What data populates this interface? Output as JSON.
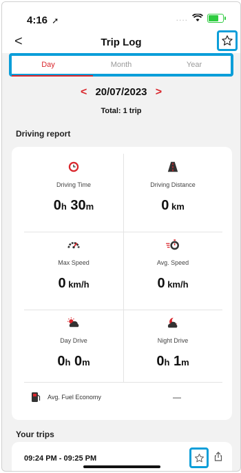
{
  "status_bar": {
    "time": "4:16",
    "location_glyph": "➚",
    "signal_dots": "....",
    "wifi_glyph": "wifi"
  },
  "header": {
    "back_glyph": "<",
    "title": "Trip Log",
    "favorite_glyph": "☆"
  },
  "tabs": [
    {
      "label": "Day",
      "active": true
    },
    {
      "label": "Month",
      "active": false
    },
    {
      "label": "Year",
      "active": false
    }
  ],
  "date": {
    "prev_glyph": "<",
    "value": "20/07/2023",
    "next_glyph": ">",
    "total": "Total: 1 trip"
  },
  "driving_report": {
    "section_title": "Driving report",
    "metrics": [
      {
        "icon": "clock-icon",
        "label": "Driving Time",
        "value_parts": [
          [
            "0",
            "big"
          ],
          [
            "h",
            "small"
          ],
          [
            " 30",
            "big"
          ],
          [
            "m",
            "small"
          ]
        ]
      },
      {
        "icon": "road-icon",
        "label": "Driving Distance",
        "value_parts": [
          [
            "0",
            "big"
          ],
          [
            " km",
            "small"
          ]
        ]
      },
      {
        "icon": "speedometer-icon",
        "label": "Max Speed",
        "value_parts": [
          [
            "0",
            "big"
          ],
          [
            " km/h",
            "small"
          ]
        ]
      },
      {
        "icon": "avg-speed-icon",
        "label": "Avg. Speed",
        "value_parts": [
          [
            "0",
            "big"
          ],
          [
            " km/h",
            "small"
          ]
        ]
      },
      {
        "icon": "sun-cloud-icon",
        "label": "Day Drive",
        "value_parts": [
          [
            "0",
            "big"
          ],
          [
            "h",
            "small"
          ],
          [
            " 0",
            "big"
          ],
          [
            "m",
            "small"
          ]
        ]
      },
      {
        "icon": "moon-cloud-icon",
        "label": "Night Drive",
        "value_parts": [
          [
            "0",
            "big"
          ],
          [
            "h",
            "small"
          ],
          [
            " 1",
            "big"
          ],
          [
            "m",
            "small"
          ]
        ]
      }
    ],
    "fuel": {
      "icon": "fuel-pump-icon",
      "label": "Avg. Fuel Economy",
      "value": "—"
    }
  },
  "your_trips": {
    "section_title": "Your trips",
    "items": [
      {
        "time_range": "09:24 PM - 09:25 PM",
        "favorite_glyph": "☆",
        "share_icon": "share-icon"
      }
    ]
  },
  "colors": {
    "accent": "#d9262c",
    "highlight": "#0b9ed9",
    "battery": "#2ecc40",
    "background": "#f2f2f2"
  }
}
